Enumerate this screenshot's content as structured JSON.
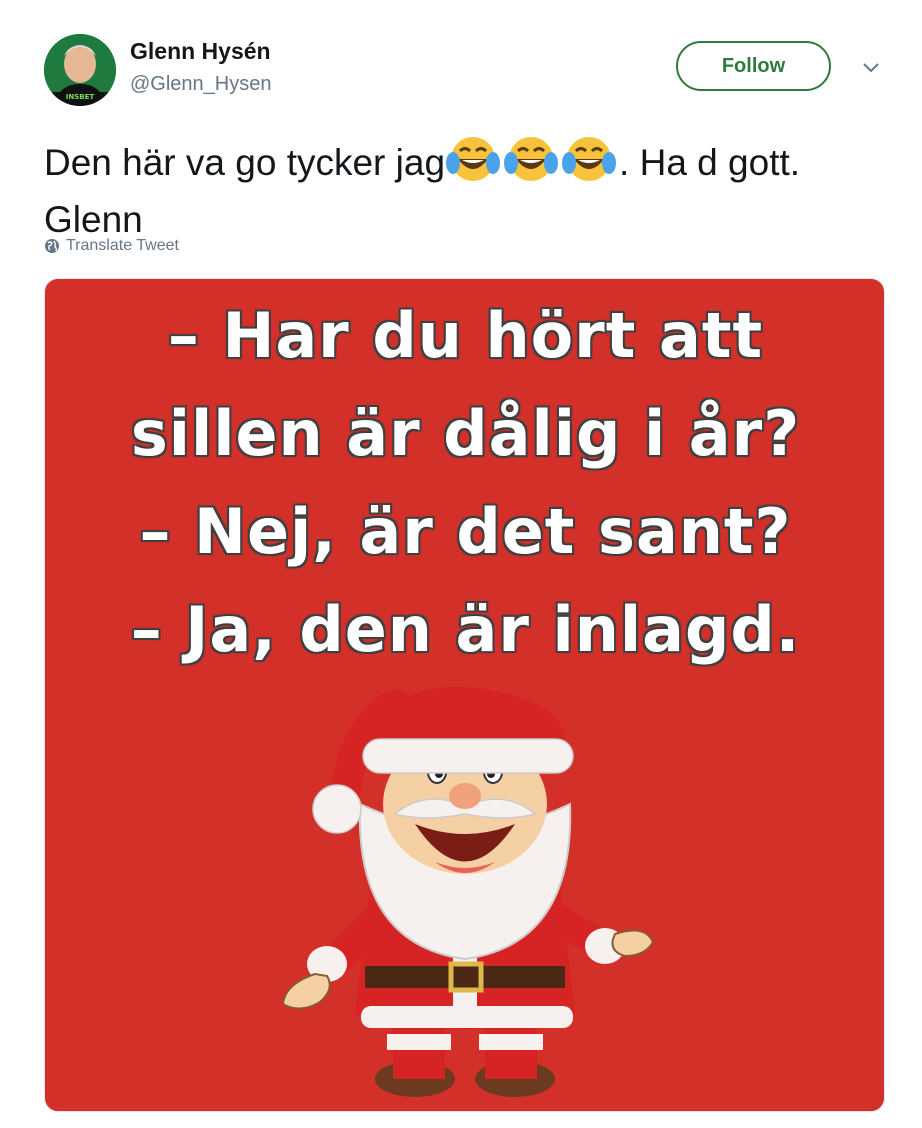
{
  "author": {
    "name": "Glenn Hysén",
    "handle": "@Glenn_Hysen",
    "avatar_label": "INSBET"
  },
  "follow_label": "Follow",
  "tweet": {
    "text_before": "Den här va go tycker jag",
    "emoji": [
      "face-with-tears-of-joy-icon",
      "face-with-tears-of-joy-icon",
      "face-with-tears-of-joy-icon"
    ],
    "text_after": ". Ha d gott. Glenn"
  },
  "translate_label": "Translate Tweet",
  "image": {
    "lines": [
      "– Har du hört att",
      "sillen är dålig i år?",
      "– Nej, är det sant?",
      "– Ja, den är inlagd."
    ],
    "background": "#d3302a"
  },
  "colors": {
    "follow": "#2f7a3b",
    "secondary_text": "#657786"
  }
}
